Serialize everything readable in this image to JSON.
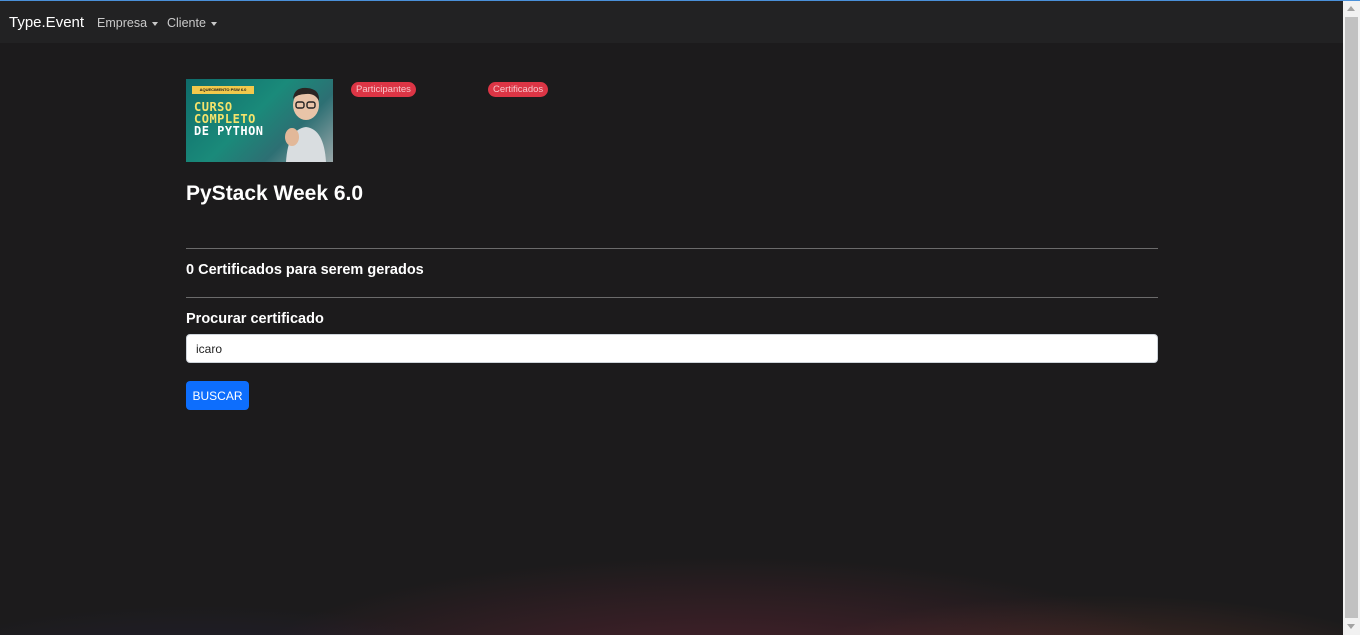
{
  "navbar": {
    "brand": "Type.Event",
    "menus": [
      {
        "label": "Empresa"
      },
      {
        "label": "Cliente"
      }
    ]
  },
  "event": {
    "thumbnail": {
      "strip_text": "AQUECIMENTO PSW 6.0",
      "line1": "CURSO",
      "line2": "COMPLETO",
      "line3": "DE PYTHON"
    },
    "badges": {
      "participants": "Participantes",
      "certificates": "Certificados"
    },
    "title": "PyStack Week 6.0"
  },
  "certificates": {
    "to_generate": "0 Certificados para serem gerados"
  },
  "search": {
    "label": "Procurar certificado",
    "value": "icaro",
    "button": "BUSCAR"
  },
  "colors": {
    "badge": "#dc3545",
    "primary_button": "#0d6efd",
    "background": "#1c1b1c"
  }
}
